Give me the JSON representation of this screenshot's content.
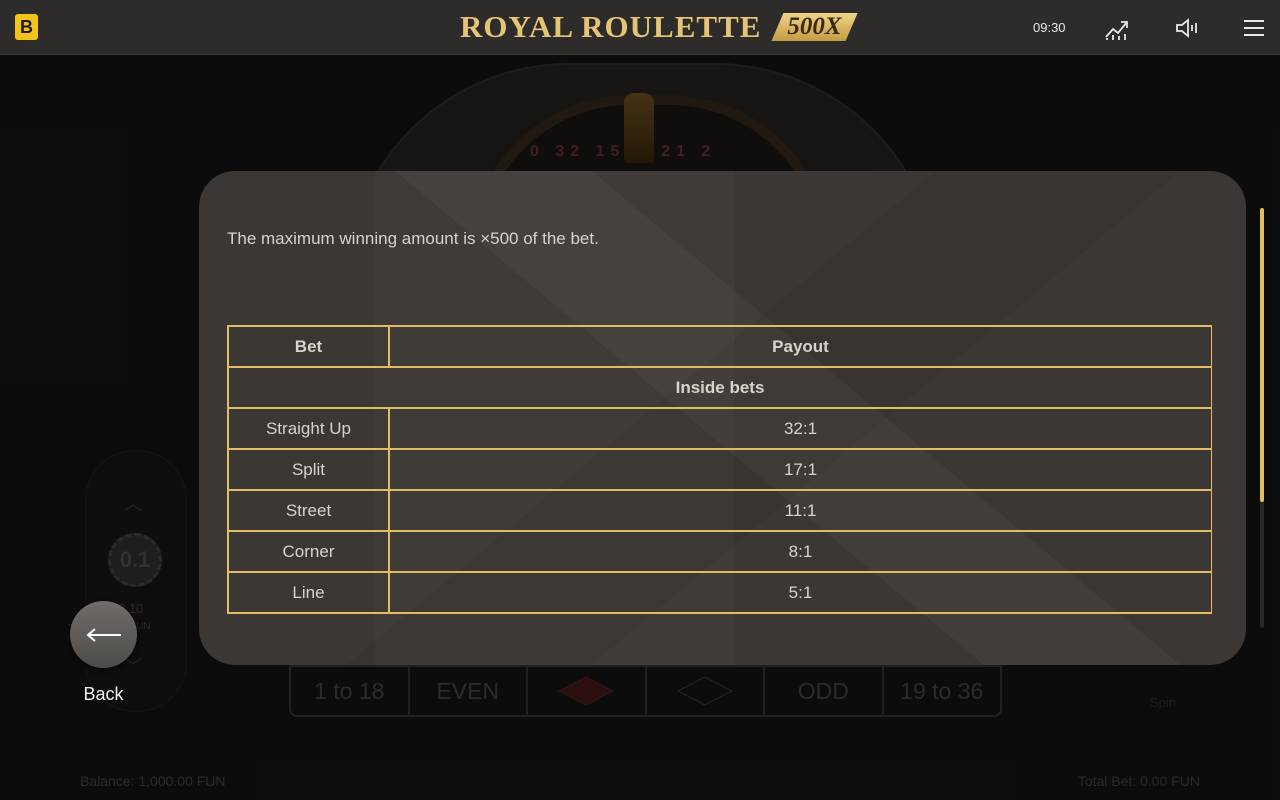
{
  "header": {
    "logo_letter": "B",
    "title_word": "ROYAL ROULETTE",
    "title_badge": "500X",
    "clock": "09:30"
  },
  "icons": {
    "stats": "chart-trend-icon",
    "sound": "speaker-icon",
    "menu": "hamburger-menu-icon",
    "back": "arrow-left-icon"
  },
  "scene": {
    "wheel_numbers": "0 32 15 4 21 2",
    "chip_value": "0.1",
    "chip_amount": "0.10",
    "chip_currency": "FUN",
    "bets": [
      "1 to 18",
      "EVEN",
      "",
      "",
      "ODD",
      "19 to 36"
    ],
    "spin_label": "Spin",
    "balance": "Balance: 1,000.00 FUN",
    "total_bet": "Total Bet: 0.00 FUN"
  },
  "modal": {
    "max_text": "The maximum winning amount is ×500 of the bet.",
    "table": {
      "headers": [
        "Bet",
        "Payout"
      ],
      "section": "Inside bets",
      "rows": [
        {
          "bet": "Straight Up",
          "payout": "32:1"
        },
        {
          "bet": "Split",
          "payout": "17:1"
        },
        {
          "bet": "Street",
          "payout": "11:1"
        },
        {
          "bet": "Corner",
          "payout": "8:1"
        },
        {
          "bet": "Line",
          "payout": "5:1"
        }
      ]
    },
    "scroll_fraction": 0.7
  },
  "back_button": {
    "label": "Back"
  },
  "colors": {
    "accent_gold": "#e3bb63",
    "brand_yellow": "#f4c318",
    "modal_bg": "#3b3734"
  }
}
